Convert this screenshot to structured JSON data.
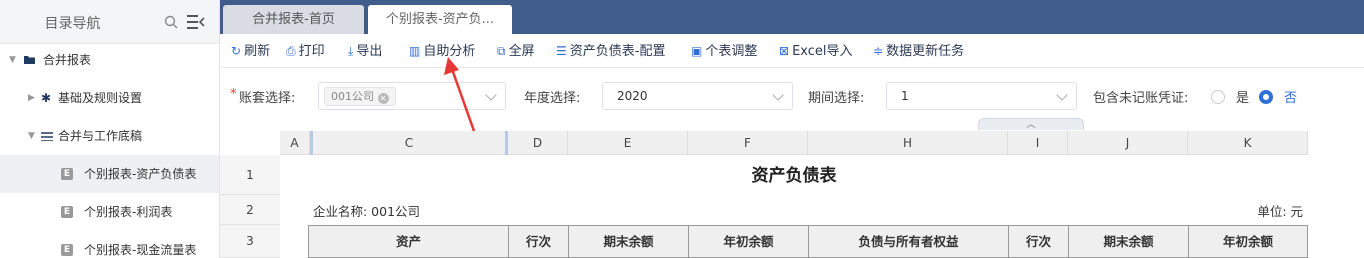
{
  "sidebar": {
    "title": "目录导航",
    "items": [
      {
        "label": "合并报表"
      },
      {
        "label": "基础及规则设置"
      },
      {
        "label": "合并与工作底稿"
      },
      {
        "label": "个别报表-资产负债表"
      },
      {
        "label": "个别报表-利润表"
      },
      {
        "label": "个别报表-现金流量表"
      }
    ]
  },
  "tabs": [
    {
      "label": "合并报表-首页"
    },
    {
      "label": "个别报表-资产负..."
    }
  ],
  "toolbar": {
    "refresh": "刷新",
    "print": "打印",
    "export": "导出",
    "analysis": "自助分析",
    "fullscreen": "全屏",
    "config": "资产负债表-配置",
    "adjust": "个表调整",
    "excel_import": "Excel导入",
    "update_task": "数据更新任务"
  },
  "filters": {
    "required_mark": "*",
    "account_label": "账套选择:",
    "account_tag": "001公司",
    "year_label": "年度选择:",
    "year_value": "2020",
    "period_label": "期间选择:",
    "period_value": "1",
    "unposted_label": "包含未记账凭证:",
    "yes": "是",
    "no": "否",
    "selected": "否"
  },
  "sheet": {
    "columns": [
      "A",
      "C",
      "D",
      "E",
      "F",
      "H",
      "I",
      "J",
      "K"
    ],
    "rows": [
      "1",
      "2",
      "3"
    ],
    "title": "资产负债表",
    "company": "企业名称: 001公司",
    "unit": "单位: 元",
    "headers": [
      "资产",
      "行次",
      "期末余额",
      "年初余额",
      "负债与所有者权益",
      "行次",
      "期末余额",
      "年初余额"
    ]
  },
  "colors": {
    "topbar": "#3f5c8a",
    "accent": "#2f6fd6",
    "annotation_arrow": "#e53935"
  }
}
